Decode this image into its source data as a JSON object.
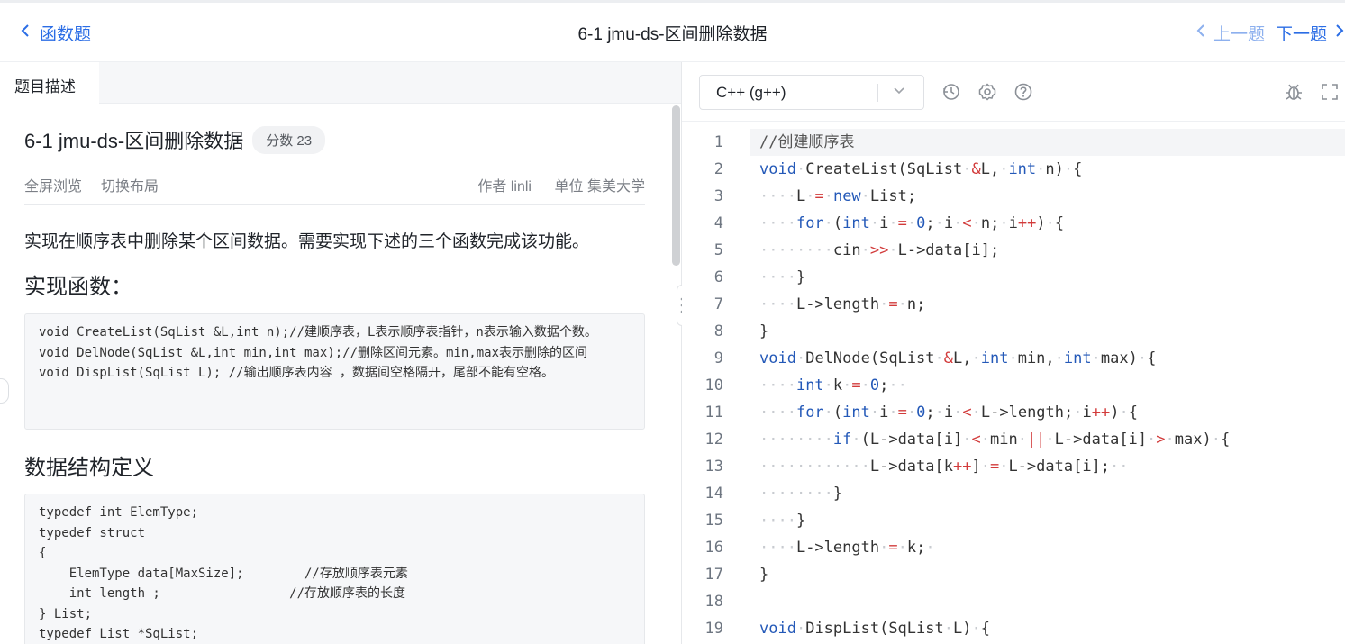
{
  "topbar": {
    "back_label": "函数题",
    "title": "6-1 jmu-ds-区间删除数据",
    "prev_label": "上一题",
    "next_label": "下一题"
  },
  "left": {
    "tab_label": "题目描述",
    "problem_title": "6-1 jmu-ds-区间删除数据",
    "score_label": "分数 23",
    "fullscreen_label": "全屏浏览",
    "switch_layout_label": "切换布局",
    "author_label": "作者 linli",
    "unit_label": "单位 集美大学",
    "description": "实现在顺序表中删除某个区间数据。需要实现下述的三个函数完成该功能。",
    "impl_heading": "实现函数：",
    "impl_code": [
      "void CreateList(SqList &L,int n);//建顺序表，L表示顺序表指针，n表示输入数据个数。",
      "void DelNode(SqList &L,int min,int max);//删除区间元素。min,max表示删除的区间",
      "void DispList(SqList L); //输出顺序表内容 ，数据间空格隔开，尾部不能有空格。"
    ],
    "ds_heading": "数据结构定义",
    "ds_code": [
      "typedef int ElemType;",
      "typedef struct",
      "{",
      "    ElemType data[MaxSize];        //存放顺序表元素",
      "    int length ;                 //存放顺序表的长度",
      "} List;",
      "typedef List *SqList;"
    ]
  },
  "editor": {
    "language": "C++ (g++)",
    "icons": [
      "history-icon",
      "settings-icon",
      "help-icon",
      "debug-icon",
      "fullscreen-icon"
    ],
    "line_numbers": [
      "1",
      "2",
      "3",
      "4",
      "5",
      "6",
      "7",
      "8",
      "9",
      "10",
      "11",
      "12",
      "13",
      "14",
      "15",
      "16",
      "17",
      "18",
      "19"
    ],
    "lines": [
      "//创建顺序表",
      "void CreateList(SqList &L, int n) {",
      "    L = new List;",
      "    for (int i = 0; i < n; i++) {",
      "        cin >> L->data[i];",
      "    }",
      "    L->length = n;",
      "}",
      "void DelNode(SqList &L, int min, int max) {",
      "    int k = 0;  ",
      "    for (int i = 0; i < L->length; i++) {",
      "        if (L->data[i] < min || L->data[i] > max) {",
      "            L->data[k++] = L->data[i];  ",
      "        }",
      "    }",
      "    L->length = k; ",
      "}",
      "",
      "void DispList(SqList L) {"
    ],
    "colors": {
      "keyword": "#2459b8",
      "operator": "#d23b3b",
      "accent": "#2b6de5"
    }
  }
}
